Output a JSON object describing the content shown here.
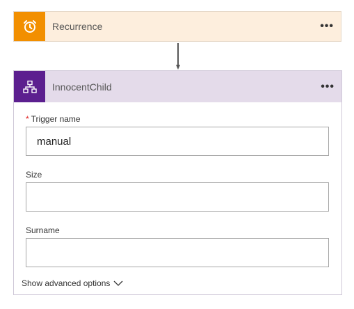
{
  "recurrence": {
    "title": "Recurrence",
    "icon": "alarm-clock-icon",
    "menu": "•••",
    "color": "#f28f00"
  },
  "child": {
    "title": "InnocentChild",
    "icon": "hierarchy-icon",
    "menu": "•••",
    "color": "#5c1f8f",
    "fields": [
      {
        "label": "Trigger name",
        "required": "*",
        "value": "manual"
      },
      {
        "label": "Size",
        "value": ""
      },
      {
        "label": "Surname",
        "value": ""
      }
    ],
    "advanced_label": "Show advanced options"
  }
}
